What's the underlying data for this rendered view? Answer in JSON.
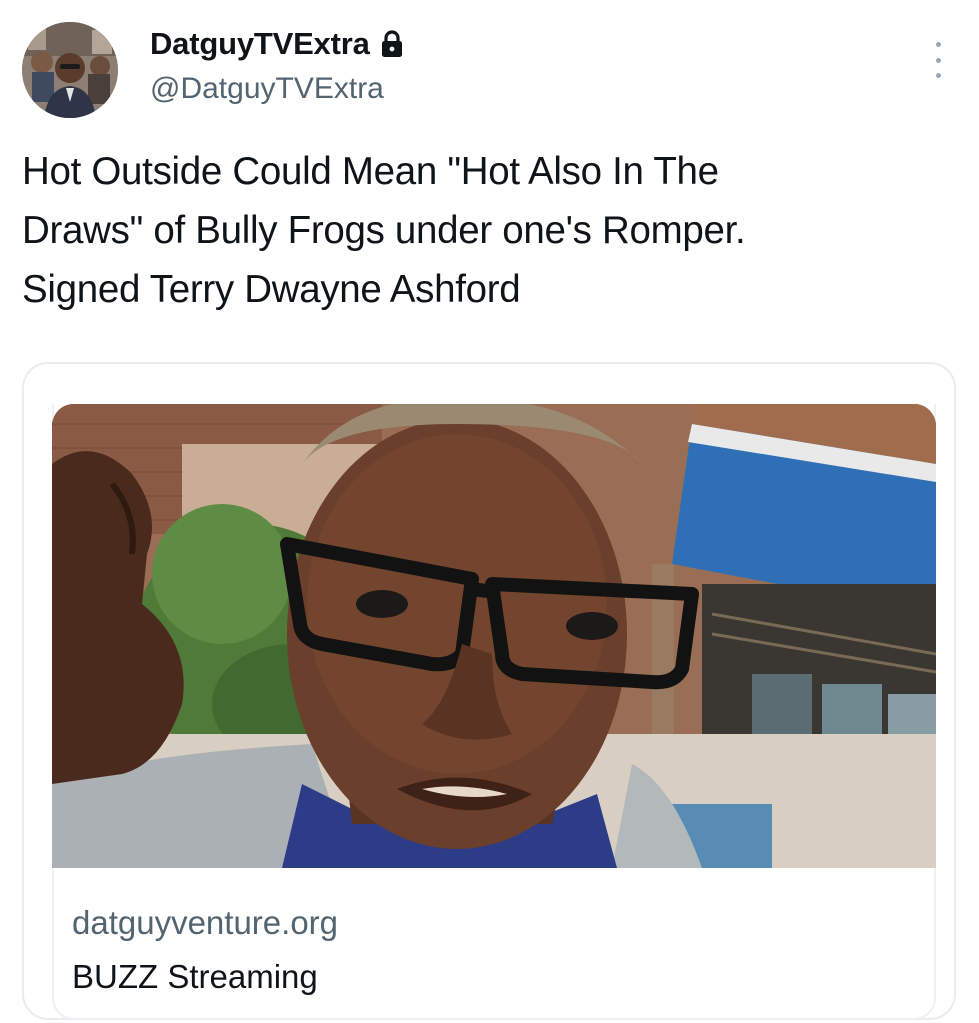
{
  "user": {
    "display_name": "DatguyTVExtra",
    "handle": "@DatguyTVExtra",
    "avatar_icon": "avatar",
    "protected_icon": "lock-icon"
  },
  "tweet": {
    "lines": [
      "Hot Outside Could Mean \"Hot Also In The",
      "Draws\" of Bully Frogs under one's Romper.",
      "Signed Terry Dwayne Ashford"
    ]
  },
  "menu": {
    "icon": "more-vertical-icon"
  },
  "card": {
    "domain": "datguyventure.org",
    "title": "BUZZ Streaming",
    "image_icon": "card-photo"
  },
  "colors": {
    "text": "#0f1419",
    "secondary": "#536471",
    "card_border": "#e9edf0",
    "awning_blue": "#2f6fb6"
  }
}
